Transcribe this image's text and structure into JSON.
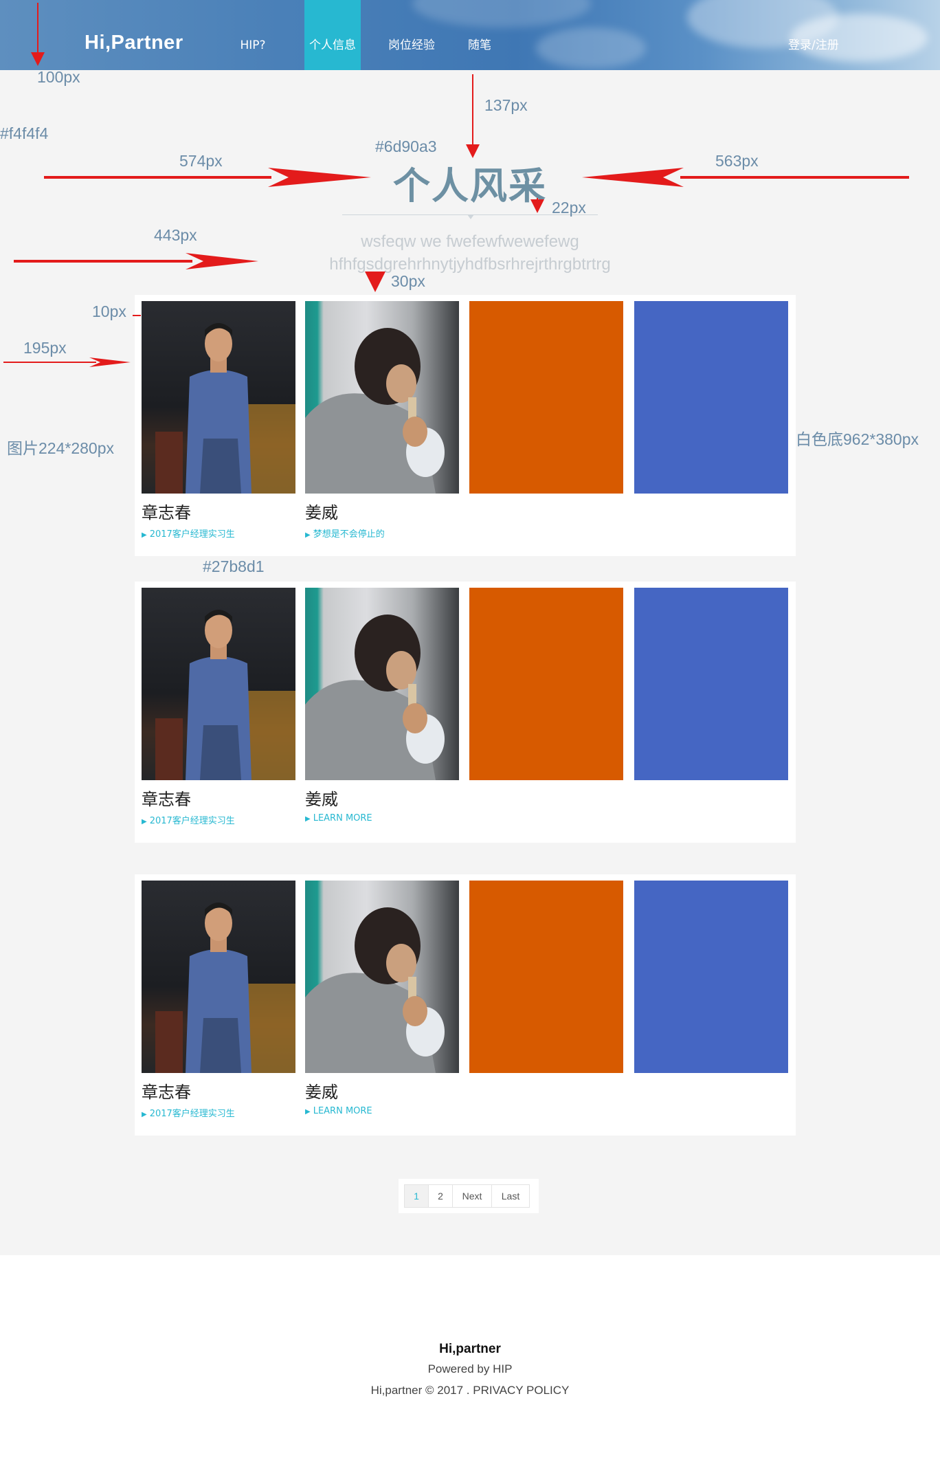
{
  "header": {
    "logo": "Hi,Partner",
    "nav": [
      {
        "label": "HIP?"
      },
      {
        "label": "个人信息"
      },
      {
        "label": "岗位经验"
      },
      {
        "label": "随笔"
      }
    ],
    "login": "登录/注册"
  },
  "section": {
    "title": "个人风采",
    "subtitle_line1": "wsfeqw we fwefewfwewefewg",
    "subtitle_line2": "hfhfgsdgrehrhnytjyhdfbsrhrejrthrgbtrtrg"
  },
  "annotations": {
    "a_100": "100px",
    "a_bg": "#f4f4f4",
    "a_137": "137px",
    "a_title_color": "#6d90a3",
    "a_574": "574px",
    "a_563": "563px",
    "a_22": "22px",
    "a_443": "443px",
    "a_30": "30px",
    "a_10": "10px",
    "a_195": "195px",
    "a_img": "图片224*280px",
    "a_panel": "白色底962*380px",
    "a_accent": "#27b8d1"
  },
  "panels": [
    {
      "cards": [
        {
          "name": "章志春",
          "tag": "2017客户经理实习生"
        },
        {
          "name": "姜威",
          "tag": "梦想是不会停止的"
        },
        {
          "name": "",
          "tag": ""
        },
        {
          "name": "",
          "tag": ""
        }
      ]
    },
    {
      "cards": [
        {
          "name": "章志春",
          "tag": "2017客户经理实习生"
        },
        {
          "name": "姜威",
          "tag": "LEARN MORE"
        },
        {
          "name": "",
          "tag": ""
        },
        {
          "name": "",
          "tag": ""
        }
      ]
    },
    {
      "cards": [
        {
          "name": "章志春",
          "tag": "2017客户经理实习生"
        },
        {
          "name": "姜威",
          "tag": "LEARN MORE"
        },
        {
          "name": "",
          "tag": ""
        },
        {
          "name": "",
          "tag": ""
        }
      ]
    }
  ],
  "pagination": {
    "pages": [
      "1",
      "2",
      "Next",
      "Last"
    ],
    "current": "1"
  },
  "footer": {
    "brand": "Hi,partner",
    "powered": "Powered by HIP",
    "copyright": "Hi,partner © 2017 . PRIVACY POLICY"
  },
  "colors": {
    "page_bg": "#f4f4f4",
    "title": "#6d90a3",
    "accent": "#27b8d1",
    "orange_block": "#d75a00",
    "blue_block": "#4566c3"
  }
}
